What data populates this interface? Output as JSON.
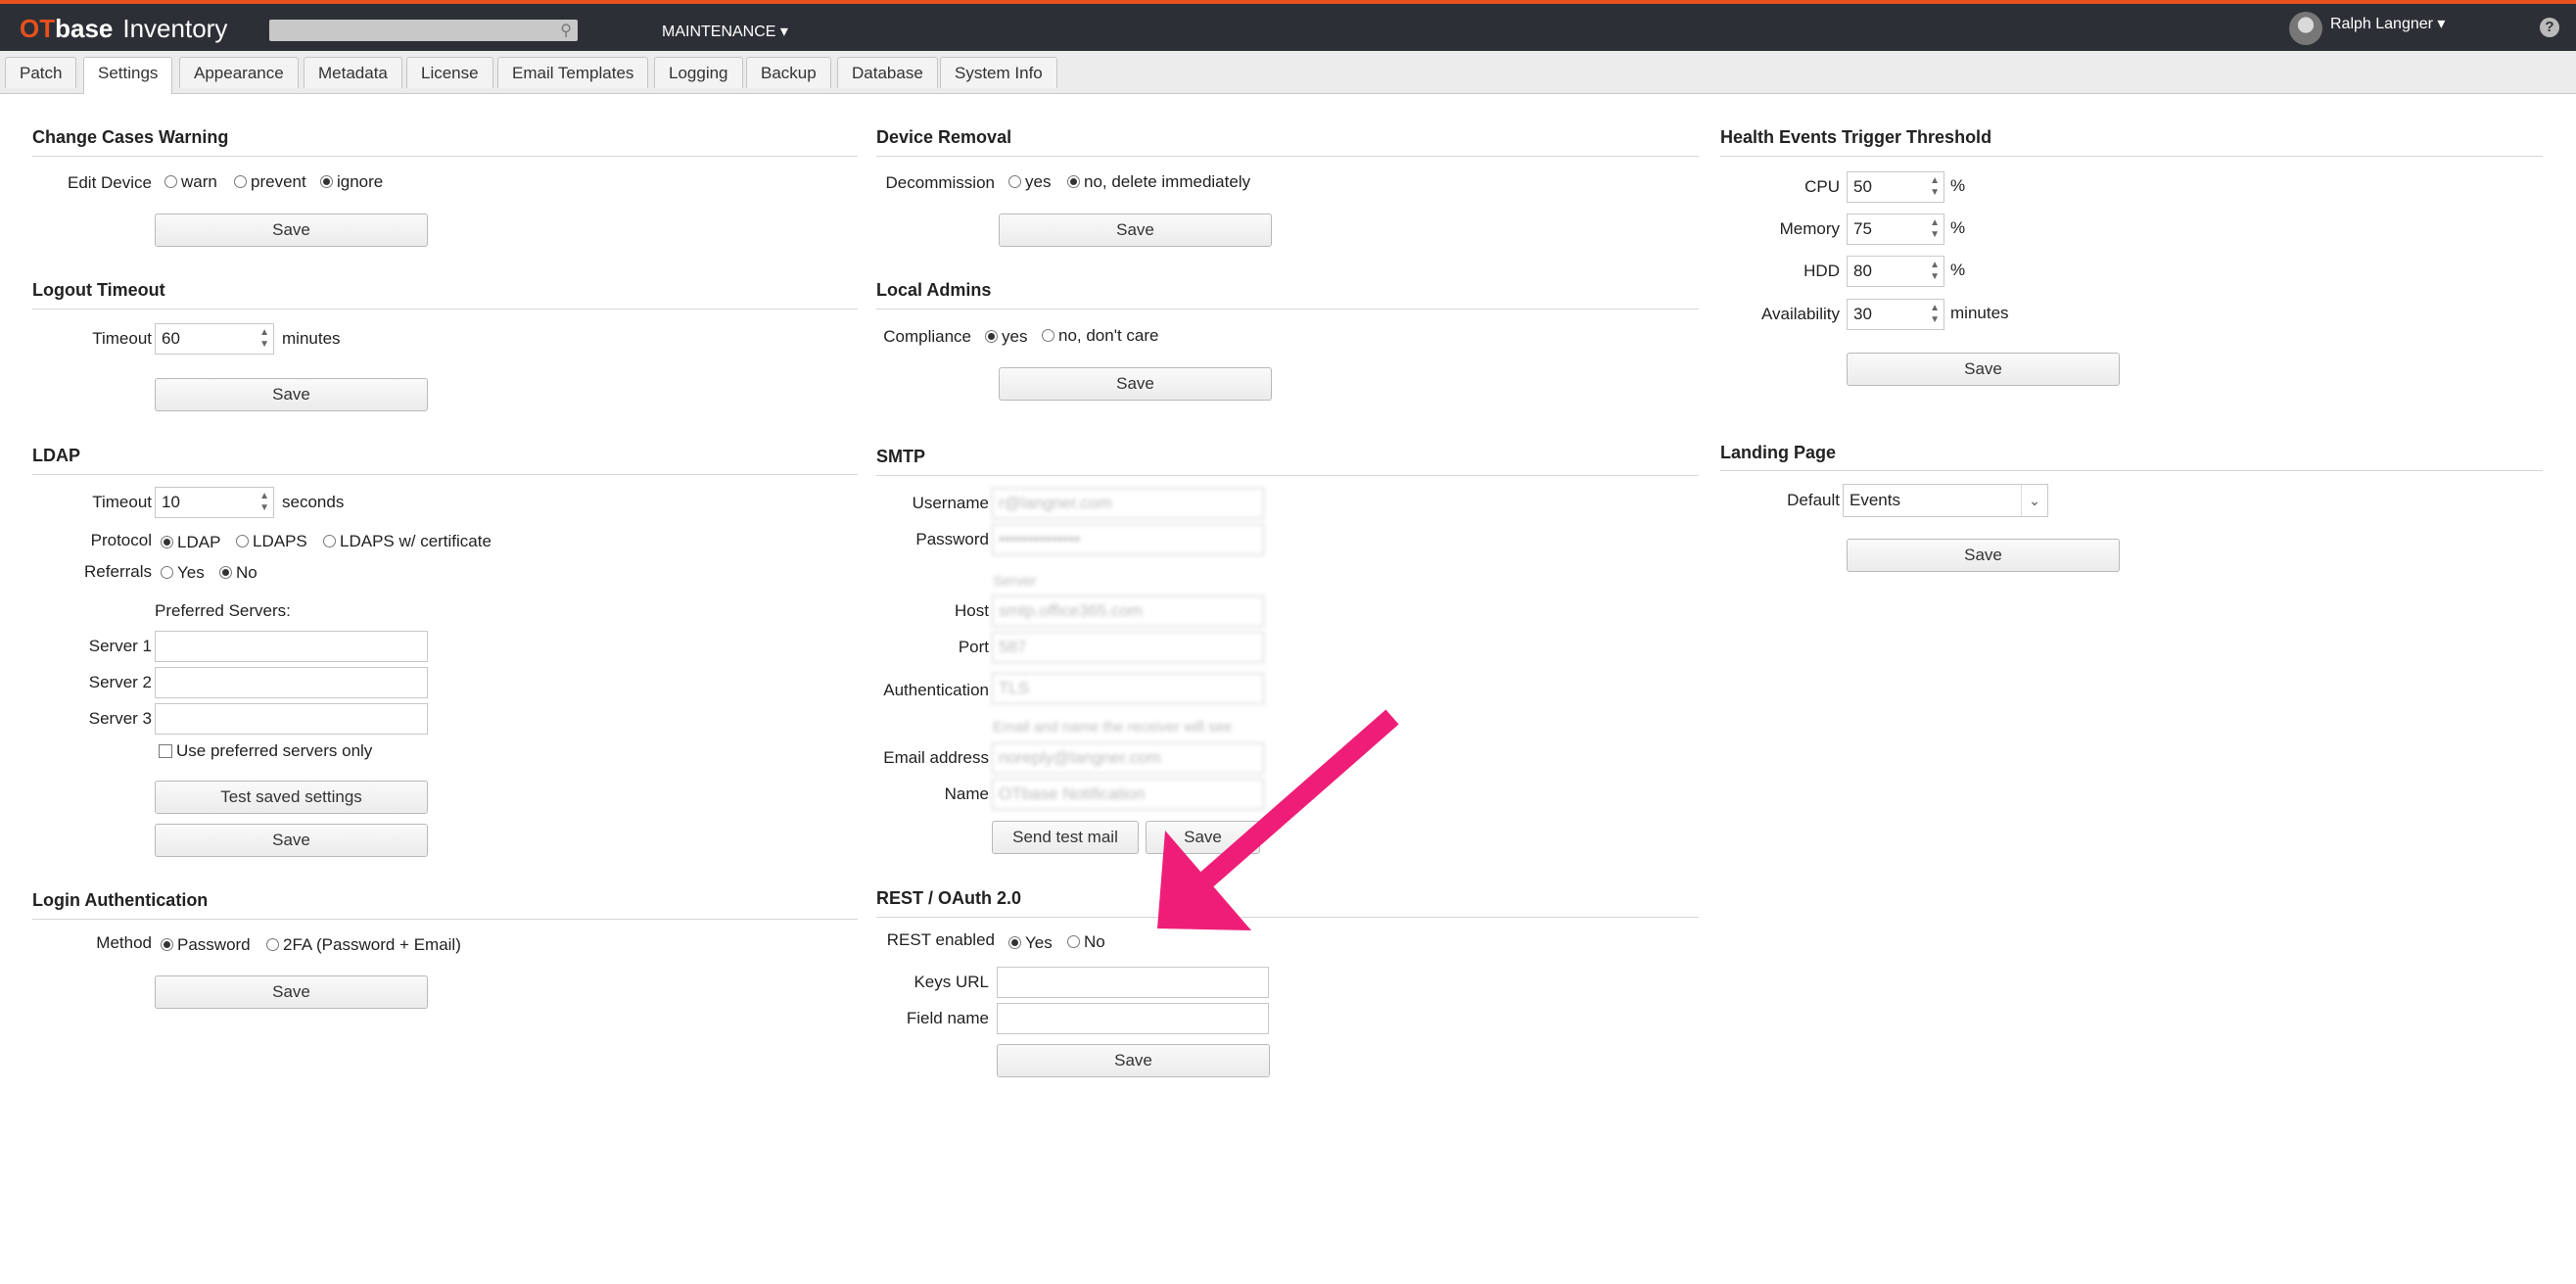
{
  "app": {
    "brand_ot": "OT",
    "brand_base": "base",
    "brand_inventory": "Inventory"
  },
  "topnav": {
    "maintenance": "MAINTENANCE ▾",
    "user": "Ralph Langner ▾",
    "help": "?"
  },
  "tabs": [
    "Patch",
    "Settings",
    "Appearance",
    "Metadata",
    "License",
    "Email Templates",
    "Logging",
    "Backup",
    "Database",
    "System Info"
  ],
  "common": {
    "save": "Save"
  },
  "change_cases": {
    "title": "Change Cases Warning",
    "label": "Edit Device",
    "options": [
      "warn",
      "prevent",
      "ignore"
    ],
    "selected": "ignore"
  },
  "logout": {
    "title": "Logout Timeout",
    "label": "Timeout",
    "value": "60",
    "unit": "minutes"
  },
  "ldap": {
    "title": "LDAP",
    "timeout_label": "Timeout",
    "timeout_value": "10",
    "timeout_unit": "seconds",
    "protocol_label": "Protocol",
    "protocol_options": [
      "LDAP",
      "LDAPS",
      "LDAPS w/ certificate"
    ],
    "protocol_selected": "LDAP",
    "referrals_label": "Referrals",
    "referrals_options": [
      "Yes",
      "No"
    ],
    "referrals_selected": "No",
    "preferred_label": "Preferred Servers:",
    "server1": "Server 1",
    "server2": "Server 2",
    "server3": "Server 3",
    "use_preferred": "Use preferred servers only",
    "test_button": "Test saved settings"
  },
  "login_auth": {
    "title": "Login Authentication",
    "label": "Method",
    "options": [
      "Password",
      "2FA (Password + Email)"
    ],
    "selected": "Password"
  },
  "device_removal": {
    "title": "Device Removal",
    "label": "Decommission",
    "options": [
      "yes",
      "no, delete immediately"
    ],
    "selected": "no, delete immediately"
  },
  "local_admins": {
    "title": "Local Admins",
    "label": "Compliance",
    "options": [
      "yes",
      "no, don't care"
    ],
    "selected": "yes"
  },
  "smtp": {
    "title": "SMTP",
    "username_label": "Username",
    "username_value": "r@langner.com",
    "password_label": "Password",
    "password_value": "••••••••••••••",
    "server_caption": "Server",
    "host_label": "Host",
    "host_value": "smtp.office365.com",
    "port_label": "Port",
    "port_value": "587",
    "auth_label": "Authentication",
    "auth_value": "TLS",
    "email_caption": "Email and name the receiver will see",
    "email_label": "Email address",
    "email_value": "noreply@langner.com",
    "name_label": "Name",
    "name_value": "OTbase Notification",
    "test_button": "Send test mail"
  },
  "rest": {
    "title": "REST / OAuth 2.0",
    "enabled_label": "REST enabled",
    "options": [
      "Yes",
      "No"
    ],
    "selected": "Yes",
    "keys_label": "Keys URL",
    "field_label": "Field name"
  },
  "health": {
    "title": "Health Events Trigger Threshold",
    "cpu_label": "CPU",
    "cpu_value": "50",
    "memory_label": "Memory",
    "memory_value": "75",
    "hdd_label": "HDD",
    "hdd_value": "80",
    "availability_label": "Availability",
    "availability_value": "30",
    "percent": "%",
    "minutes": "minutes"
  },
  "landing": {
    "title": "Landing Page",
    "label": "Default",
    "value": "Events"
  },
  "colors": {
    "accent": "#e8501e",
    "topbar": "#2c3036",
    "arrow": "#ee1e78"
  }
}
